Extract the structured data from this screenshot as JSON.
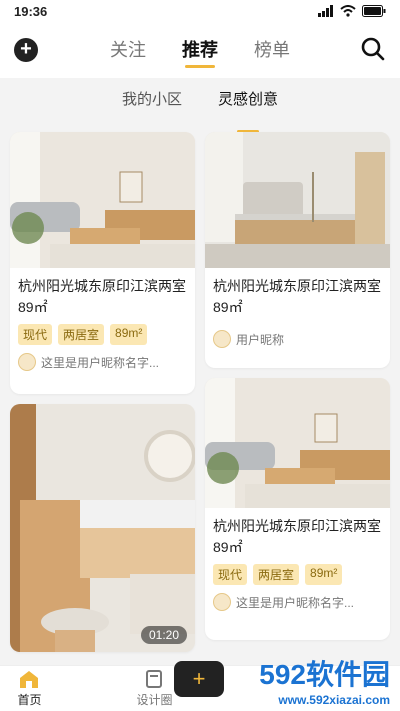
{
  "status_bar": {
    "time": "19:36"
  },
  "top_tabs": [
    {
      "label": "关注",
      "active": false
    },
    {
      "label": "推荐",
      "active": true
    },
    {
      "label": "榜单",
      "active": false
    }
  ],
  "sub_tabs": [
    {
      "label": "我的小区",
      "active": false
    },
    {
      "label": "灵感创意",
      "active": true
    }
  ],
  "cards": [
    {
      "title": "杭州阳光城东原印江滨两室89㎡",
      "tags": [
        "现代",
        "两居室",
        "89m²"
      ],
      "user": "这里是用户昵称名字..."
    },
    {
      "title": "杭州阳光城东原印江滨两室89㎡",
      "tags": [],
      "user": "用户昵称"
    },
    {
      "title": "",
      "tags": [],
      "user": "",
      "duration": "01:20"
    },
    {
      "title": "杭州阳光城东原印江滨两室89㎡",
      "tags": [
        "现代",
        "两居室",
        "89m²"
      ],
      "user": "这里是用户昵称名字..."
    }
  ],
  "bottom_nav": [
    {
      "label": "首页",
      "icon": "home-icon",
      "active": true
    },
    {
      "label": "设计圈",
      "icon": "design-circle-icon",
      "active": false
    }
  ],
  "watermark": {
    "brand": "592软件园",
    "url": "www.592xiazai.com"
  }
}
